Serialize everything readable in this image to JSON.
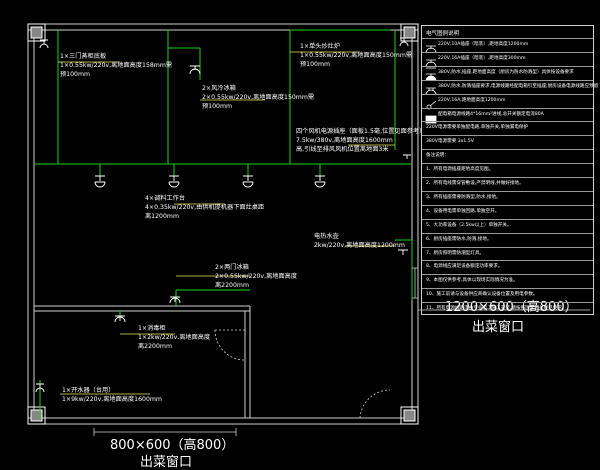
{
  "equipment": [
    {
      "id": "eq1",
      "line1": "1×三门蒸柜底板",
      "line2": "1×0.55kw/220v,离地面高度158mm需",
      "line3": "预100mm"
    },
    {
      "id": "eq2",
      "line1": "2×风冷冰箱",
      "line2": "2×0.55kw/220v,离地面高度150mm需",
      "line3": "预100mm"
    },
    {
      "id": "eq3",
      "line1": "1×单头炒灶炉",
      "line2": "1×0.55kw/220v,离地面高度150mm需",
      "line3": "预100mm"
    },
    {
      "id": "eq4",
      "line1": "四个风机电源插座（面板1.5毫,位置见面参考）",
      "line2": "7.5kw/380v,离地面高度1600mm",
      "line3": "高,引线至排风风机位置离地面3米"
    },
    {
      "id": "eq5",
      "line1": "4×调料工作台",
      "line2": "4×0.35kw/220v,由供机提机器下面灶桌距",
      "line3": "离1200mm"
    },
    {
      "id": "eq6",
      "line1": "2×两门冰箱",
      "line2": "2×0.55kw/220v,离地面高度",
      "line3": "离2200mm"
    },
    {
      "id": "eq7",
      "line1": "1×消毒柜",
      "line2": "1×2kw/220v,离地面高度",
      "line3": "离2200mm"
    },
    {
      "id": "eq8",
      "line1": "电热水壶",
      "line2": "2kw/220v,离地面高度1200mm",
      "line3": ""
    },
    {
      "id": "eq9",
      "line1": "1×开水器（台用）",
      "line2": "1×9kw/220v,离地面高度1600mm",
      "line3": ""
    }
  ],
  "windows": {
    "right": {
      "size": "1200×600（高800）",
      "name": "出菜窗口"
    },
    "bottom": {
      "size": "800×600（高800）",
      "name": "出菜窗口"
    }
  },
  "legend": {
    "title": "电气图例说明",
    "rows": [
      {
        "symbol": "socket-5a",
        "text": "220V,10A插座（暗装）,距地高度1200mm",
        "bold": false
      },
      {
        "symbol": "socket-16a",
        "text": "220V,16A插座（暗装）,距地高度300mm",
        "bold": false
      },
      {
        "symbol": "waterproof-socket",
        "text": "380V,防水,插座,距地面高度（厨房为防水防溅型）具体按设备要求",
        "bold": false
      },
      {
        "symbol": "three-phase",
        "text": "380V,防水,防溅插座要求,电源线路经配电箱引至插座;厨房设备电源线路应预留",
        "bold": false
      },
      {
        "symbol": "switch",
        "text": "220V,16A,距地面高度1200mm",
        "bold": false
      },
      {
        "symbol": "box",
        "text": "配电箱电源线路4*16mm²进线,总开关额定电流80A",
        "bold": false
      },
      {
        "symbol": "none",
        "text": "220V电源需要单独配电路,单独开关,单独漏电保护",
        "bold": false
      },
      {
        "symbol": "none",
        "text": "380V电源需要 3x1.5V",
        "bold": false
      },
      {
        "symbol": "none",
        "text": "备注说明：",
        "bold": false
      },
      {
        "symbol": "none",
        "text": "1、所有电源插座距地高度见图。",
        "bold": false
      },
      {
        "symbol": "none",
        "text": "2、所有电线需穿管敷设,严禁明线,并做好接地。",
        "bold": false
      },
      {
        "symbol": "none",
        "text": "3、所有插座需要防溅型,防水,接地。",
        "bold": false
      },
      {
        "symbol": "none",
        "text": "4、设备用电需单独回路,单独空开。",
        "bold": false
      },
      {
        "symbol": "none",
        "text": "5、大功率设备（2.5kw以上）单独开关。",
        "bold": false
      },
      {
        "symbol": "none",
        "text": "6、厨房插座需防水,防溅,接地。",
        "bold": false
      },
      {
        "symbol": "none",
        "text": "7、厨房照明需防潮型灯具。",
        "bold": false
      },
      {
        "symbol": "none",
        "text": "8、电源线应满足设备额定功率要求。",
        "bold": false
      },
      {
        "symbol": "none",
        "text": "9、本图仅供参考,具体以现场实际情况为准。",
        "bold": false
      },
      {
        "symbol": "none",
        "text": "10、施工前请与设备供应商确认设备位置及用电参数。",
        "bold": false
      },
      {
        "symbol": "none",
        "text": "11、所有电源线路须由专业电工施工安装,请按照国家相关规范要求。",
        "bold": false
      }
    ]
  }
}
